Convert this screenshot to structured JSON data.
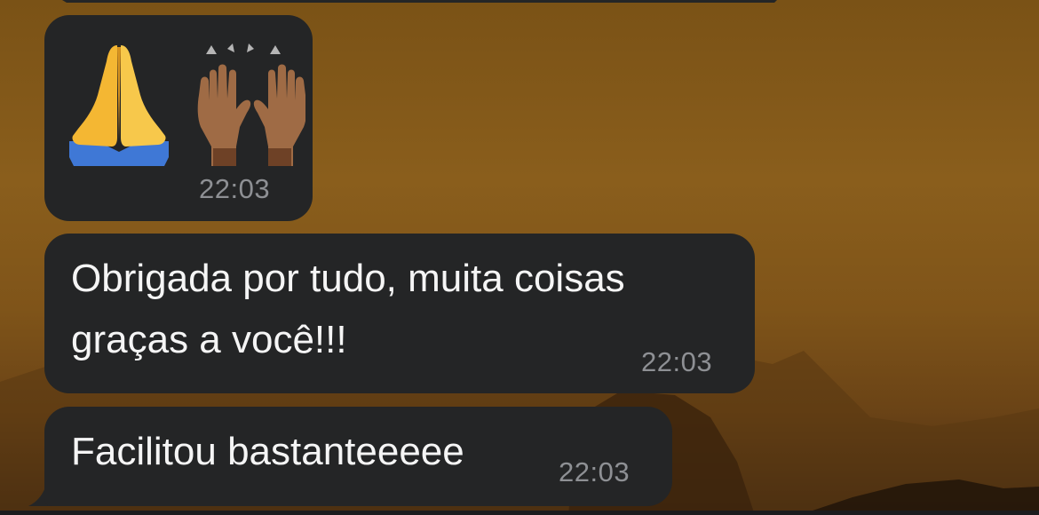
{
  "messages": [
    {
      "kind": "emoji",
      "emojis": [
        "folded-hands",
        "raising-hands-medium-dark"
      ],
      "time": "22:03"
    },
    {
      "kind": "text",
      "text": "Obrigada por tudo, muita coisas\ngraças a você!!!",
      "time": "22:03"
    },
    {
      "kind": "text",
      "text": "Facilitou bastanteeeee",
      "time": "22:03"
    }
  ],
  "colors": {
    "bubble": "#242526",
    "timestamp": "#8e9094",
    "message_text": "#f5f5f5"
  }
}
